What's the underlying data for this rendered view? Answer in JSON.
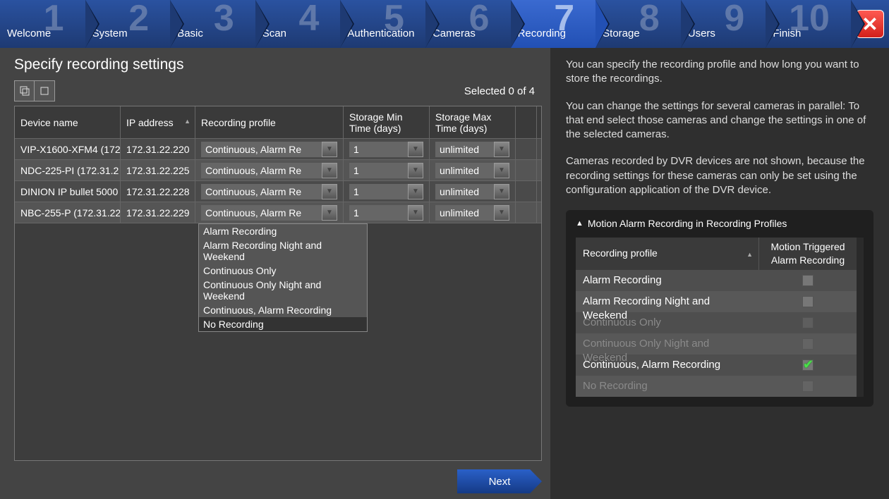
{
  "nav": {
    "steps": [
      {
        "n": "1",
        "label": "Welcome"
      },
      {
        "n": "2",
        "label": "System"
      },
      {
        "n": "3",
        "label": "Basic"
      },
      {
        "n": "4",
        "label": "Scan"
      },
      {
        "n": "5",
        "label": "Authentication"
      },
      {
        "n": "6",
        "label": "Cameras"
      },
      {
        "n": "7",
        "label": "Recording"
      },
      {
        "n": "8",
        "label": "Storage"
      },
      {
        "n": "9",
        "label": "Users"
      },
      {
        "n": "10",
        "label": "Finish"
      }
    ],
    "active_index": 6,
    "close_label": "✕"
  },
  "page_title": "Specify recording settings",
  "selected_text": "Selected 0 of 4",
  "columns": {
    "device": "Device name",
    "ip": "IP address",
    "profile": "Recording profile",
    "min": "Storage Min Time (days)",
    "max": "Storage Max Time (days)"
  },
  "rows": [
    {
      "device": "VIP-X1600-XFM4 (172",
      "ip": "172.31.22.220",
      "profile": "Continuous, Alarm Re",
      "min": "1",
      "max": "unlimited"
    },
    {
      "device": "NDC-225-PI (172.31.2",
      "ip": "172.31.22.225",
      "profile": "Continuous, Alarm Re",
      "min": "1",
      "max": "unlimited"
    },
    {
      "device": "DINION IP bullet 5000",
      "ip": "172.31.22.228",
      "profile": "Continuous, Alarm Re",
      "min": "1",
      "max": "unlimited"
    },
    {
      "device": "NBC-255-P (172.31.22",
      "ip": "172.31.22.229",
      "profile": "Continuous, Alarm Re",
      "min": "1",
      "max": "unlimited"
    }
  ],
  "profile_options": [
    "Alarm Recording",
    "Alarm Recording Night and Weekend",
    "Continuous Only",
    "Continuous Only Night and Weekend",
    "Continuous, Alarm Recording",
    "No Recording"
  ],
  "profile_selected_option": "No Recording",
  "next_label": "Next",
  "help": {
    "p1": "You can specify the recording profile and how long you want to store the recordings.",
    "p2": "You can change the settings for several cameras in parallel: To that end select those cameras and change the settings in one of the selected cameras.",
    "p3": "Cameras recorded by DVR devices are not shown, because the recording settings for these cameras can only be set using the configuration application of the DVR device."
  },
  "panel": {
    "title": "Motion Alarm Recording in Recording Profiles",
    "col1": "Recording profile",
    "col2": "Motion Triggered Alarm Recording",
    "rows": [
      {
        "name": "Alarm Recording",
        "checked": false,
        "dim": false
      },
      {
        "name": "Alarm Recording Night and Weekend",
        "checked": false,
        "dim": false
      },
      {
        "name": "Continuous Only",
        "checked": false,
        "dim": true
      },
      {
        "name": "Continuous Only Night and Weekend",
        "checked": false,
        "dim": true
      },
      {
        "name": "Continuous, Alarm Recording",
        "checked": true,
        "dim": false
      },
      {
        "name": "No Recording",
        "checked": false,
        "dim": true
      }
    ]
  }
}
